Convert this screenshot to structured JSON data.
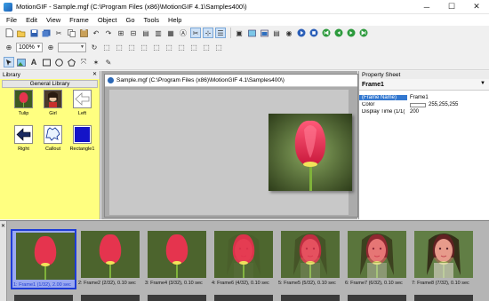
{
  "window": {
    "title": "MotionGIF - Sample.mgf (C:\\Program Files (x86)\\MotionGIF 4.1\\Samples400\\)",
    "minimize": "─",
    "maximize": "☐",
    "close": "✕"
  },
  "menu": [
    "File",
    "Edit",
    "View",
    "Frame",
    "Object",
    "Go",
    "Tools",
    "Help"
  ],
  "toolbar": {
    "zoom_value": "100%",
    "second_combo": "",
    "third_combo": ""
  },
  "library": {
    "title": "Library",
    "close": "✕",
    "tab": "General Library",
    "items": [
      {
        "label": "Tulip",
        "icon": "tulip-icon"
      },
      {
        "label": "Girl",
        "icon": "girl-icon"
      },
      {
        "label": "Left",
        "icon": "left-arrow-icon"
      },
      {
        "label": "Right",
        "icon": "right-arrow-icon"
      },
      {
        "label": "Callout",
        "icon": "callout-icon"
      },
      {
        "label": "Rectangle1",
        "icon": "rectangle-icon"
      }
    ]
  },
  "document": {
    "title": "Sample.mgf (C:\\Program Files (x86)\\MotionGIF 4.1\\Samples400\\)"
  },
  "property_sheet": {
    "title": "Property Sheet",
    "selected": "Frame1",
    "rows": [
      {
        "key": "(Frame Name)",
        "value": "Frame1"
      },
      {
        "key": "Color",
        "value": "255,255,255"
      },
      {
        "key": "Display Time (1/1(",
        "value": "200"
      }
    ],
    "color_swatch": "#ffffff"
  },
  "frames": [
    {
      "label": "1: Frame1 (1/32), 2.00 sec",
      "face": 0
    },
    {
      "label": "2: Frame2 (2/32), 0.10 sec",
      "face": 0
    },
    {
      "label": "3: Frame4 (3/32), 0.10 sec",
      "face": 0
    },
    {
      "label": "4: Frame6 (4/32), 0.10 sec",
      "face": 0.05
    },
    {
      "label": "5: Frame5 (5/32), 0.10 sec",
      "face": 0.2
    },
    {
      "label": "6: Frame7 (6/32), 0.10 sec",
      "face": 0.45
    },
    {
      "label": "7: Frame8 (7/32), 0.10 sec",
      "face": 0.7
    }
  ],
  "colors": {
    "accent": "#1e3cd6",
    "library_bg": "#ffff80",
    "selection": "#3378d0"
  }
}
